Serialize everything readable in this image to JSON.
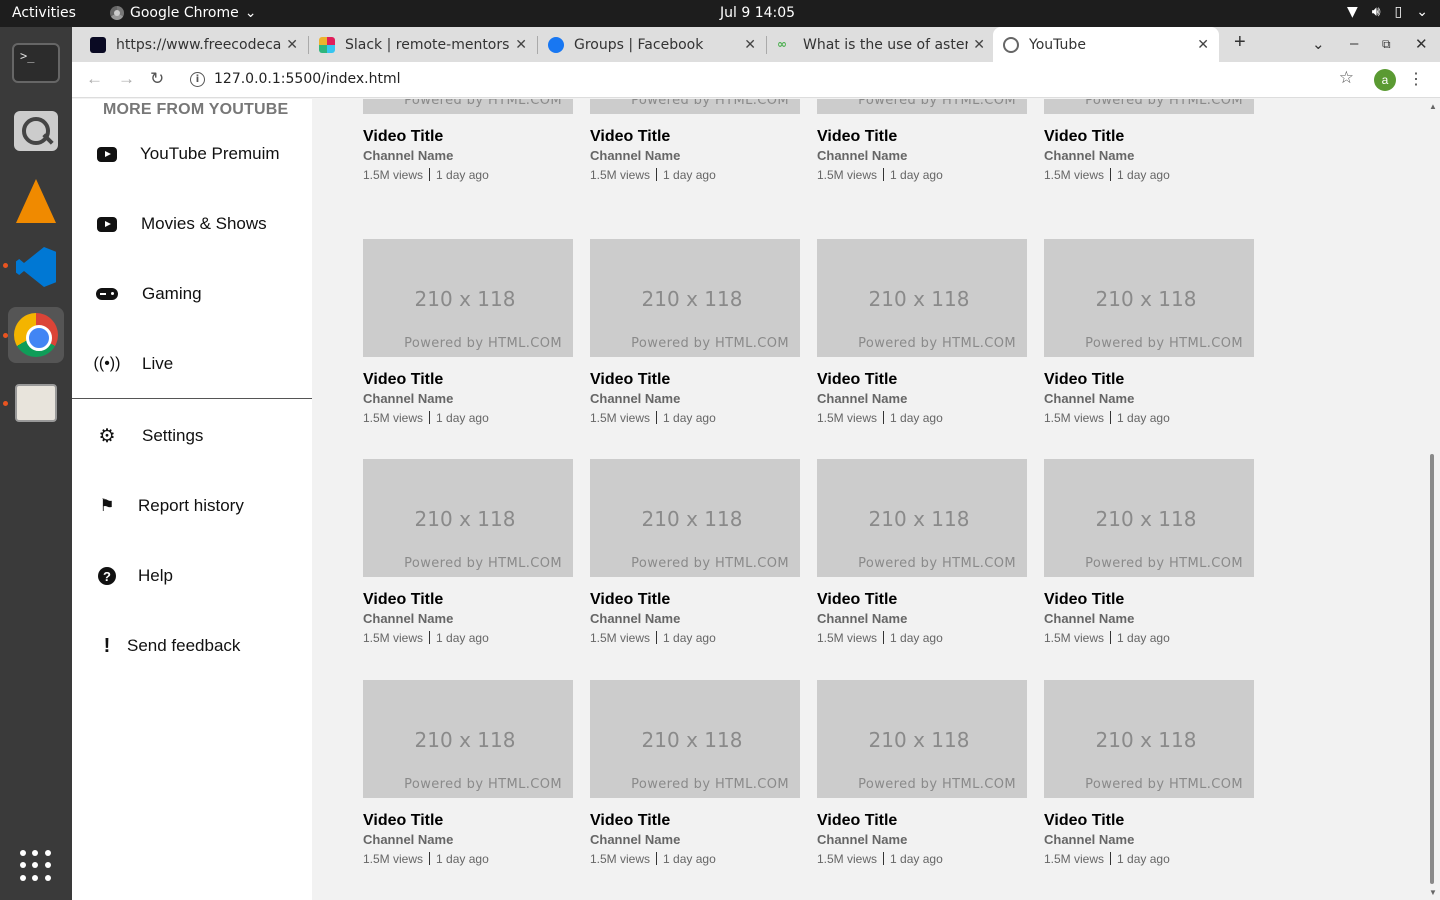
{
  "system": {
    "activities": "Activities",
    "app_name": "Google Chrome",
    "clock": "Jul 9  14:05"
  },
  "tabs": [
    {
      "title": "https://www.freecodecamp.org",
      "favicon_color": "#0a0a23"
    },
    {
      "title": "Slack | remote-mentorship",
      "favicon_color": "#4a154b"
    },
    {
      "title": "Groups | Facebook",
      "favicon_color": "#1877f2"
    },
    {
      "title": "What is the use of asterisk",
      "favicon_color": "#4caf50"
    },
    {
      "title": "YouTube",
      "favicon_color": "#666666"
    }
  ],
  "toolbar": {
    "url": "127.0.0.1:5500/index.html",
    "profile_initial": "a"
  },
  "sidebar": {
    "heading": "MORE FROM YOUTUBE",
    "items": [
      {
        "label": "YouTube Premuim",
        "icon": "youtube-icon"
      },
      {
        "label": "Movies & Shows",
        "icon": "youtube-icon"
      },
      {
        "label": "Gaming",
        "icon": "gamepad-icon"
      },
      {
        "label": "Live",
        "icon": "wifi-icon"
      },
      {
        "label": "Settings",
        "icon": "gear-icon"
      },
      {
        "label": "Report history",
        "icon": "flag-icon"
      },
      {
        "label": "Help",
        "icon": "help-icon"
      },
      {
        "label": "Send feedback",
        "icon": "exclamation-icon"
      }
    ]
  },
  "video": {
    "thumb_size": "210 x 118",
    "thumb_powered": "Powered by HTML.COM",
    "title": "Video Title",
    "channel": "Channel Name",
    "views": "1.5M views",
    "age": "1 day ago"
  }
}
